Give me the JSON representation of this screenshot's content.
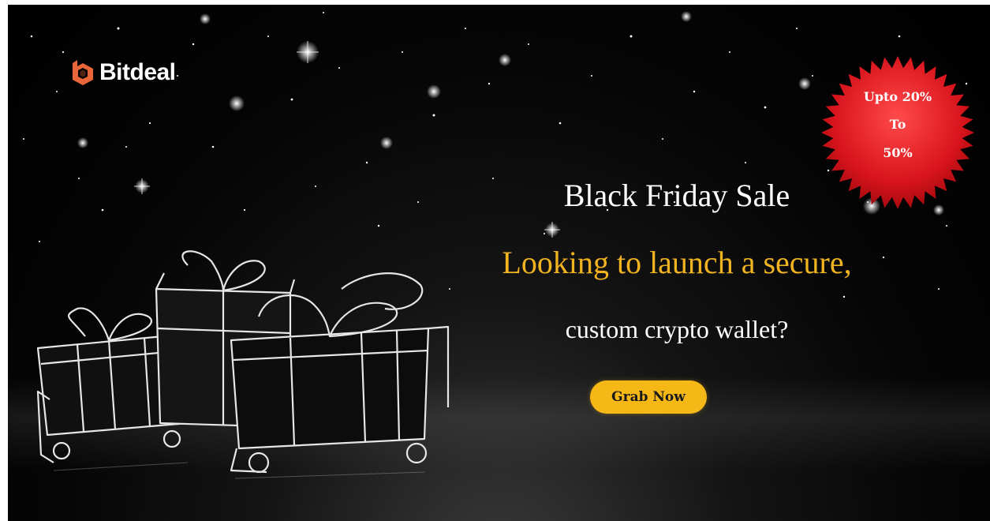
{
  "brand": {
    "name": "Bitdeal",
    "logo_color": "#e8663a"
  },
  "badge": {
    "line1": "Upto 20%",
    "line2": "To",
    "line3": "50%",
    "color": "#d8141c"
  },
  "headline": {
    "title": "Black Friday Sale",
    "subtitle": "Looking to launch a secure,",
    "question": "custom crypto wallet?"
  },
  "cta": {
    "label": "Grab Now",
    "color": "#f6b817"
  },
  "colors": {
    "background": "#000000",
    "accent": "#f2b320"
  }
}
